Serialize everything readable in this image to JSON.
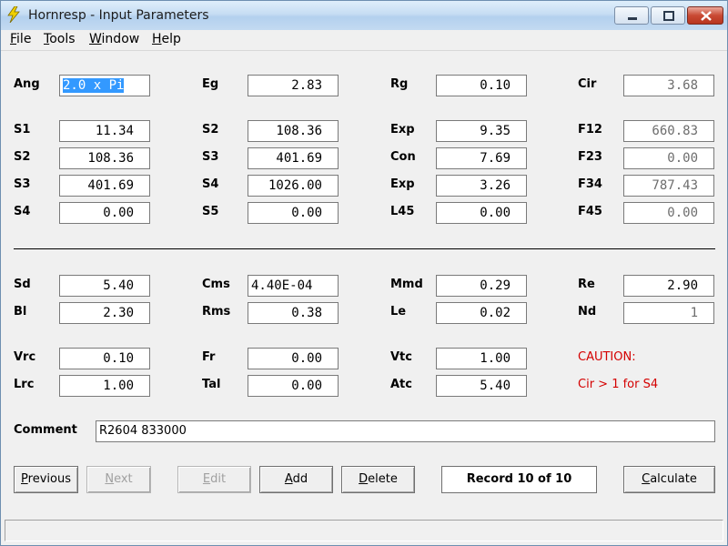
{
  "window": {
    "title": "Hornresp - Input Parameters",
    "accent_title_bar": "#c6ddf3",
    "close_button_color": "#c94a34"
  },
  "menu": [
    {
      "label": "File",
      "mnemonic": "F"
    },
    {
      "label": "Tools",
      "mnemonic": "T"
    },
    {
      "label": "Window",
      "mnemonic": "W"
    },
    {
      "label": "Help",
      "mnemonic": "H"
    }
  ],
  "horn": {
    "ang": {
      "label": "Ang",
      "value": "2.0 x Pi"
    },
    "eg": {
      "label": "Eg",
      "value": "2.83"
    },
    "rg": {
      "label": "Rg",
      "value": "0.10"
    },
    "cir": {
      "label": "Cir",
      "value": "3.68"
    },
    "s1": {
      "label": "S1",
      "value": "11.34"
    },
    "s2": {
      "label": "S2",
      "value": "108.36"
    },
    "exp1": {
      "label": "Exp",
      "value": "9.35"
    },
    "f12": {
      "label": "F12",
      "value": "660.83"
    },
    "s2b": {
      "label": "S2",
      "value": "108.36"
    },
    "s3": {
      "label": "S3",
      "value": "401.69"
    },
    "con": {
      "label": "Con",
      "value": "7.69"
    },
    "f23": {
      "label": "F23",
      "value": "0.00"
    },
    "s3b": {
      "label": "S3",
      "value": "401.69"
    },
    "s4": {
      "label": "S4",
      "value": "1026.00"
    },
    "exp2": {
      "label": "Exp",
      "value": "3.26"
    },
    "f34": {
      "label": "F34",
      "value": "787.43"
    },
    "s4b": {
      "label": "S4",
      "value": "0.00"
    },
    "s5": {
      "label": "S5",
      "value": "0.00"
    },
    "l45": {
      "label": "L45",
      "value": "0.00"
    },
    "f45": {
      "label": "F45",
      "value": "0.00"
    }
  },
  "driver": {
    "sd": {
      "label": "Sd",
      "value": "5.40"
    },
    "cms": {
      "label": "Cms",
      "value": "4.40E-04"
    },
    "mmd": {
      "label": "Mmd",
      "value": "0.29"
    },
    "re": {
      "label": "Re",
      "value": "2.90"
    },
    "bl": {
      "label": "Bl",
      "value": "2.30"
    },
    "rms": {
      "label": "Rms",
      "value": "0.38"
    },
    "le": {
      "label": "Le",
      "value": "0.02"
    },
    "nd": {
      "label": "Nd",
      "value": "1"
    }
  },
  "chamber": {
    "vrc": {
      "label": "Vrc",
      "value": "0.10"
    },
    "fr": {
      "label": "Fr",
      "value": "0.00"
    },
    "vtc": {
      "label": "Vtc",
      "value": "1.00"
    },
    "lrc": {
      "label": "Lrc",
      "value": "1.00"
    },
    "tal": {
      "label": "Tal",
      "value": "0.00"
    },
    "atc": {
      "label": "Atc",
      "value": "5.40"
    }
  },
  "caution": {
    "title": "CAUTION:",
    "message": "Cir > 1 for S4",
    "color": "#d40000"
  },
  "comment": {
    "label": "Comment",
    "value": "R2604 833000"
  },
  "buttons": {
    "previous": {
      "label": "Previous",
      "mnemonic": "P"
    },
    "next": {
      "label": "Next",
      "mnemonic": "N"
    },
    "edit": {
      "label": "Edit",
      "mnemonic": "E"
    },
    "add": {
      "label": "Add",
      "mnemonic": "A"
    },
    "delete": {
      "label": "Delete",
      "mnemonic": "D"
    },
    "calculate": {
      "label": "Calculate",
      "mnemonic": "C"
    }
  },
  "record": {
    "label": "Record 10 of 10"
  },
  "status": {
    "text": ""
  }
}
